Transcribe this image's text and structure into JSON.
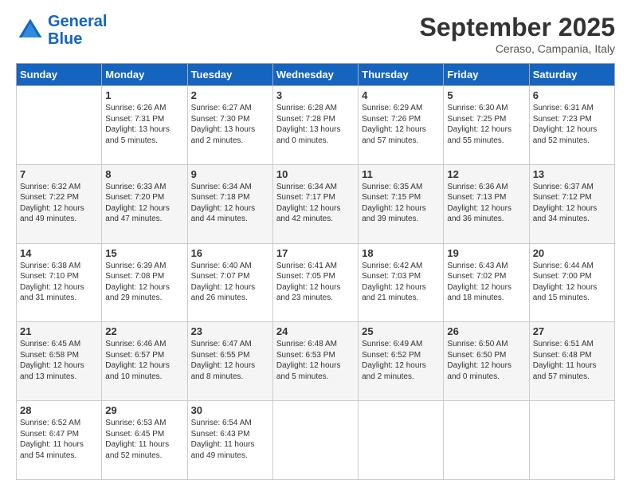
{
  "header": {
    "logo_line1": "General",
    "logo_line2": "Blue",
    "month": "September 2025",
    "location": "Ceraso, Campania, Italy"
  },
  "days_of_week": [
    "Sunday",
    "Monday",
    "Tuesday",
    "Wednesday",
    "Thursday",
    "Friday",
    "Saturday"
  ],
  "weeks": [
    [
      {
        "num": "",
        "sunrise": "",
        "sunset": "",
        "daylight": ""
      },
      {
        "num": "1",
        "sunrise": "Sunrise: 6:26 AM",
        "sunset": "Sunset: 7:31 PM",
        "daylight": "Daylight: 13 hours and 5 minutes."
      },
      {
        "num": "2",
        "sunrise": "Sunrise: 6:27 AM",
        "sunset": "Sunset: 7:30 PM",
        "daylight": "Daylight: 13 hours and 2 minutes."
      },
      {
        "num": "3",
        "sunrise": "Sunrise: 6:28 AM",
        "sunset": "Sunset: 7:28 PM",
        "daylight": "Daylight: 13 hours and 0 minutes."
      },
      {
        "num": "4",
        "sunrise": "Sunrise: 6:29 AM",
        "sunset": "Sunset: 7:26 PM",
        "daylight": "Daylight: 12 hours and 57 minutes."
      },
      {
        "num": "5",
        "sunrise": "Sunrise: 6:30 AM",
        "sunset": "Sunset: 7:25 PM",
        "daylight": "Daylight: 12 hours and 55 minutes."
      },
      {
        "num": "6",
        "sunrise": "Sunrise: 6:31 AM",
        "sunset": "Sunset: 7:23 PM",
        "daylight": "Daylight: 12 hours and 52 minutes."
      }
    ],
    [
      {
        "num": "7",
        "sunrise": "Sunrise: 6:32 AM",
        "sunset": "Sunset: 7:22 PM",
        "daylight": "Daylight: 12 hours and 49 minutes."
      },
      {
        "num": "8",
        "sunrise": "Sunrise: 6:33 AM",
        "sunset": "Sunset: 7:20 PM",
        "daylight": "Daylight: 12 hours and 47 minutes."
      },
      {
        "num": "9",
        "sunrise": "Sunrise: 6:34 AM",
        "sunset": "Sunset: 7:18 PM",
        "daylight": "Daylight: 12 hours and 44 minutes."
      },
      {
        "num": "10",
        "sunrise": "Sunrise: 6:34 AM",
        "sunset": "Sunset: 7:17 PM",
        "daylight": "Daylight: 12 hours and 42 minutes."
      },
      {
        "num": "11",
        "sunrise": "Sunrise: 6:35 AM",
        "sunset": "Sunset: 7:15 PM",
        "daylight": "Daylight: 12 hours and 39 minutes."
      },
      {
        "num": "12",
        "sunrise": "Sunrise: 6:36 AM",
        "sunset": "Sunset: 7:13 PM",
        "daylight": "Daylight: 12 hours and 36 minutes."
      },
      {
        "num": "13",
        "sunrise": "Sunrise: 6:37 AM",
        "sunset": "Sunset: 7:12 PM",
        "daylight": "Daylight: 12 hours and 34 minutes."
      }
    ],
    [
      {
        "num": "14",
        "sunrise": "Sunrise: 6:38 AM",
        "sunset": "Sunset: 7:10 PM",
        "daylight": "Daylight: 12 hours and 31 minutes."
      },
      {
        "num": "15",
        "sunrise": "Sunrise: 6:39 AM",
        "sunset": "Sunset: 7:08 PM",
        "daylight": "Daylight: 12 hours and 29 minutes."
      },
      {
        "num": "16",
        "sunrise": "Sunrise: 6:40 AM",
        "sunset": "Sunset: 7:07 PM",
        "daylight": "Daylight: 12 hours and 26 minutes."
      },
      {
        "num": "17",
        "sunrise": "Sunrise: 6:41 AM",
        "sunset": "Sunset: 7:05 PM",
        "daylight": "Daylight: 12 hours and 23 minutes."
      },
      {
        "num": "18",
        "sunrise": "Sunrise: 6:42 AM",
        "sunset": "Sunset: 7:03 PM",
        "daylight": "Daylight: 12 hours and 21 minutes."
      },
      {
        "num": "19",
        "sunrise": "Sunrise: 6:43 AM",
        "sunset": "Sunset: 7:02 PM",
        "daylight": "Daylight: 12 hours and 18 minutes."
      },
      {
        "num": "20",
        "sunrise": "Sunrise: 6:44 AM",
        "sunset": "Sunset: 7:00 PM",
        "daylight": "Daylight: 12 hours and 15 minutes."
      }
    ],
    [
      {
        "num": "21",
        "sunrise": "Sunrise: 6:45 AM",
        "sunset": "Sunset: 6:58 PM",
        "daylight": "Daylight: 12 hours and 13 minutes."
      },
      {
        "num": "22",
        "sunrise": "Sunrise: 6:46 AM",
        "sunset": "Sunset: 6:57 PM",
        "daylight": "Daylight: 12 hours and 10 minutes."
      },
      {
        "num": "23",
        "sunrise": "Sunrise: 6:47 AM",
        "sunset": "Sunset: 6:55 PM",
        "daylight": "Daylight: 12 hours and 8 minutes."
      },
      {
        "num": "24",
        "sunrise": "Sunrise: 6:48 AM",
        "sunset": "Sunset: 6:53 PM",
        "daylight": "Daylight: 12 hours and 5 minutes."
      },
      {
        "num": "25",
        "sunrise": "Sunrise: 6:49 AM",
        "sunset": "Sunset: 6:52 PM",
        "daylight": "Daylight: 12 hours and 2 minutes."
      },
      {
        "num": "26",
        "sunrise": "Sunrise: 6:50 AM",
        "sunset": "Sunset: 6:50 PM",
        "daylight": "Daylight: 12 hours and 0 minutes."
      },
      {
        "num": "27",
        "sunrise": "Sunrise: 6:51 AM",
        "sunset": "Sunset: 6:48 PM",
        "daylight": "Daylight: 11 hours and 57 minutes."
      }
    ],
    [
      {
        "num": "28",
        "sunrise": "Sunrise: 6:52 AM",
        "sunset": "Sunset: 6:47 PM",
        "daylight": "Daylight: 11 hours and 54 minutes."
      },
      {
        "num": "29",
        "sunrise": "Sunrise: 6:53 AM",
        "sunset": "Sunset: 6:45 PM",
        "daylight": "Daylight: 11 hours and 52 minutes."
      },
      {
        "num": "30",
        "sunrise": "Sunrise: 6:54 AM",
        "sunset": "Sunset: 6:43 PM",
        "daylight": "Daylight: 11 hours and 49 minutes."
      },
      {
        "num": "",
        "sunrise": "",
        "sunset": "",
        "daylight": ""
      },
      {
        "num": "",
        "sunrise": "",
        "sunset": "",
        "daylight": ""
      },
      {
        "num": "",
        "sunrise": "",
        "sunset": "",
        "daylight": ""
      },
      {
        "num": "",
        "sunrise": "",
        "sunset": "",
        "daylight": ""
      }
    ]
  ]
}
